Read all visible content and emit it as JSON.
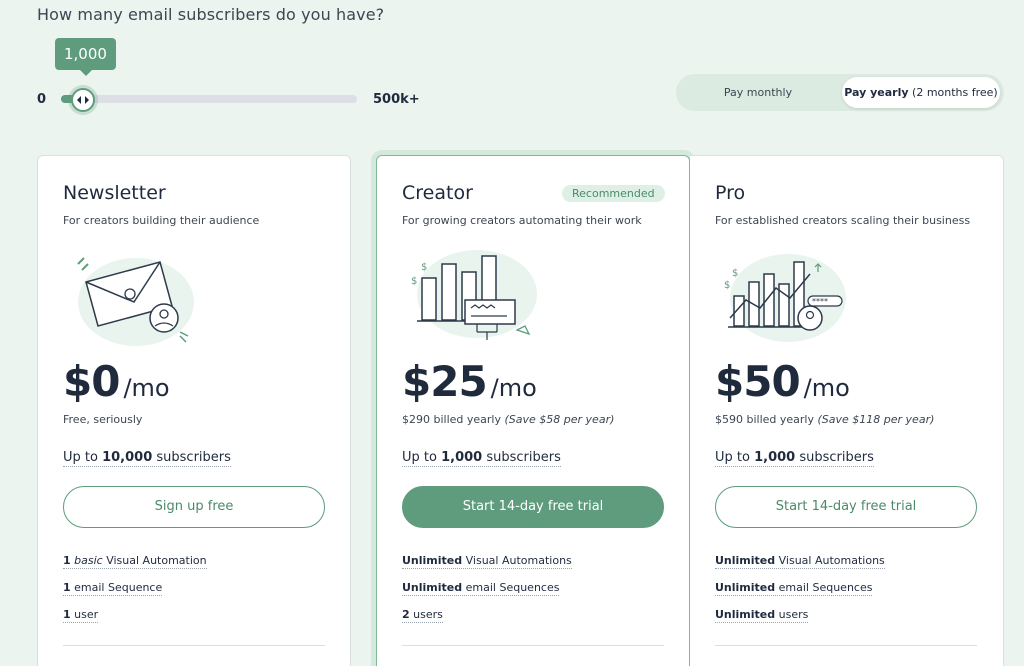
{
  "question": "How many email subscribers do you have?",
  "slider": {
    "value_label": "1,000",
    "min_label": "0",
    "max_label": "500k+",
    "fill_fraction": 0.05
  },
  "billing": {
    "monthly_label": "Pay monthly",
    "yearly_label": "Pay yearly",
    "yearly_note": "(2 months free)",
    "selected": "yearly"
  },
  "colors": {
    "accent": "#5e9c7d",
    "text": "#1f2a3d",
    "background": "#ecf4ef"
  },
  "plans": [
    {
      "name": "Newsletter",
      "subtitle": "For creators building their audience",
      "badge": "",
      "price": "$0",
      "unit": "/mo",
      "note": "Free, seriously",
      "note_save": "",
      "subs_prefix": "Up to ",
      "subs_count": "10,000",
      "subs_suffix": " subscribers",
      "cta": "Sign up free",
      "illustration": "envelope-illustration",
      "features": [
        {
          "bold": "1",
          "italic": "basic",
          "text": " Visual Automation"
        },
        {
          "bold": "1",
          "italic": "",
          "text": " email Sequence"
        },
        {
          "bold": "1",
          "italic": "",
          "text": " user"
        }
      ]
    },
    {
      "name": "Creator",
      "subtitle": "For growing creators automating their work",
      "badge": "Recommended",
      "price": "$25",
      "unit": "/mo",
      "note": "$290 billed yearly ",
      "note_save": "(Save $58 per year)",
      "subs_prefix": "Up to ",
      "subs_count": "1,000",
      "subs_suffix": " subscribers",
      "cta": "Start 14-day free trial",
      "illustration": "bar-chart-illustration",
      "features": [
        {
          "bold": "Unlimited",
          "italic": "",
          "text": " Visual Automations"
        },
        {
          "bold": "Unlimited",
          "italic": "",
          "text": " email Sequences"
        },
        {
          "bold": "2",
          "italic": "",
          "text": " users"
        }
      ]
    },
    {
      "name": "Pro",
      "subtitle": "For established creators scaling their business",
      "badge": "",
      "price": "$50",
      "unit": "/mo",
      "note": "$590 billed yearly ",
      "note_save": "(Save $118 per year)",
      "subs_prefix": "Up to ",
      "subs_count": "1,000",
      "subs_suffix": " subscribers",
      "cta": "Start 14-day free trial",
      "illustration": "growth-chart-illustration",
      "features": [
        {
          "bold": "Unlimited",
          "italic": "",
          "text": " Visual Automations"
        },
        {
          "bold": "Unlimited",
          "italic": "",
          "text": " email Sequences"
        },
        {
          "bold": "Unlimited",
          "italic": "",
          "text": " users"
        }
      ]
    }
  ]
}
